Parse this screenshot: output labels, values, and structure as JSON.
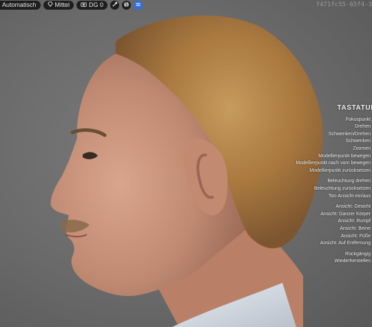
{
  "toolbar": {
    "render_mode": "Automatisch",
    "quality": "Mittel",
    "dg_label": "DG 0",
    "icons": [
      "diamond-icon",
      "camera-icon",
      "globe-icon",
      "settings-icon"
    ]
  },
  "asset_id": "f471fc55-65f4-3",
  "shortcuts": {
    "heading": "TASTATUR",
    "groups": [
      {
        "items": [
          "Fokuspunkt",
          "Drehen",
          "Schwenken/Drehen",
          "Schwenken",
          "Zoomen",
          "Modellierpunkt bewegen",
          "Modellierpunkt nach vorn bewegen",
          "Modellierpunkt zurücksetzen"
        ]
      },
      {
        "items": [
          "Beleuchtung drehen",
          "Beleuchtung zurücksetzen",
          "Ton-Ansicht ein/aus"
        ]
      },
      {
        "items": [
          "Ansicht: Gesicht",
          "Ansicht: Ganzer Körper",
          "Ansicht: Rumpf",
          "Ansicht: Beine",
          "Ansicht: Füße",
          "Ansicht: Auf Entfernung"
        ]
      },
      {
        "items": [
          "Rückgängig",
          "Wiederherstellen"
        ]
      }
    ]
  },
  "colors": {
    "background": "#6b6b6b",
    "toolbar": "#1e1e1e",
    "accent": "#2f6fde",
    "hair": "#b8894f",
    "skin": "#c8927a"
  }
}
